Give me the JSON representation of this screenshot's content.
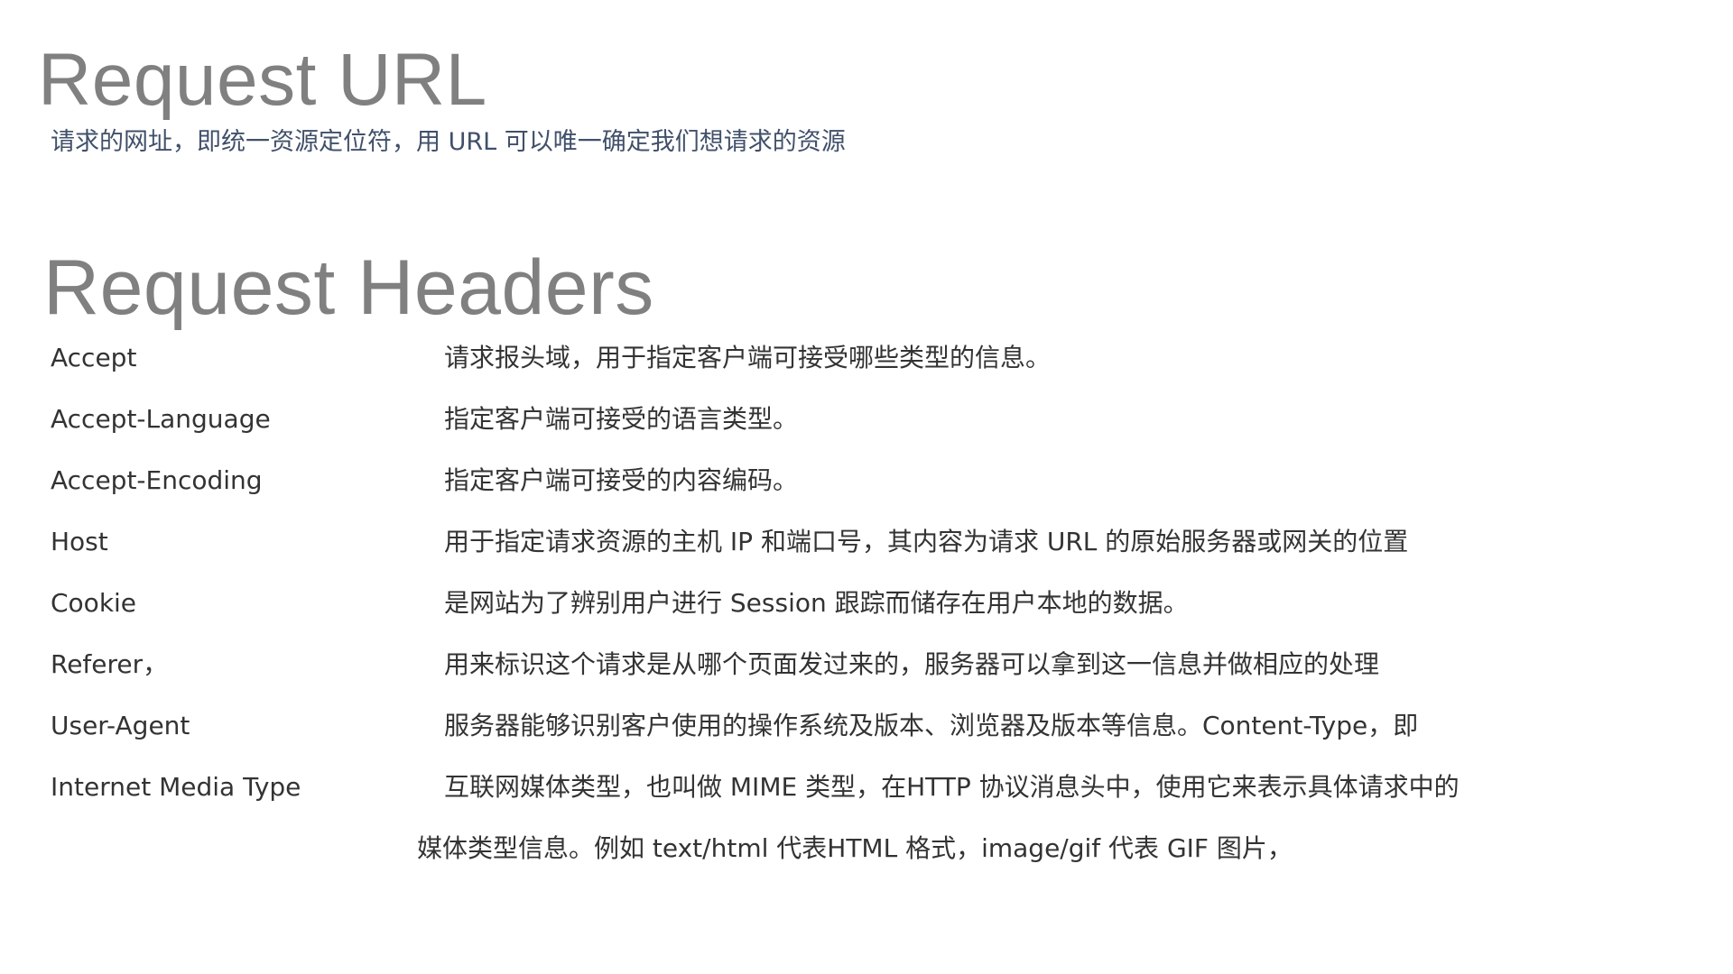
{
  "section_url": {
    "title": "Request URL",
    "description": "请求的网址，即统一资源定位符，用 URL 可以唯一确定我们想请求的资源"
  },
  "section_headers": {
    "title": "Request Headers",
    "rows": [
      {
        "name": "Accept",
        "description": "请求报头域，用于指定客户端可接受哪些类型的信息。"
      },
      {
        "name": "Accept-Language",
        "description": "指定客户端可接受的语言类型。"
      },
      {
        "name": "Accept-Encoding",
        "description": "指定客户端可接受的内容编码。"
      },
      {
        "name": "Host",
        "description": "用于指定请求资源的主机  IP  和端口号，其内容为请求  URL  的原始服务器或网关的位置"
      },
      {
        "name": "Cookie",
        "description": "是网站为了辨别用户进行 Session 跟踪而储存在用户本地的数据。"
      },
      {
        "name": "Referer，",
        "description": "用来标识这个请求是从哪个页面发过来的，服务器可以拿到这一信息并做相应的处理"
      },
      {
        "name": "User-Agent",
        "description": "服务器能够识别客户使用的操作系统及版本、浏览器及版本等信息。Content-Type，即"
      },
      {
        "name": "Internet Media Type",
        "description": "互联网媒体类型，也叫做 MIME 类型，在HTTP 协议消息头中，使用它来表示具体请求中的"
      }
    ],
    "continuation": "媒体类型信息。例如 text/html 代表HTML 格式，image/gif 代表 GIF 图片，"
  },
  "colors": {
    "heading": "#808080",
    "subtitle": "#41506a",
    "body_text": "#333333"
  }
}
